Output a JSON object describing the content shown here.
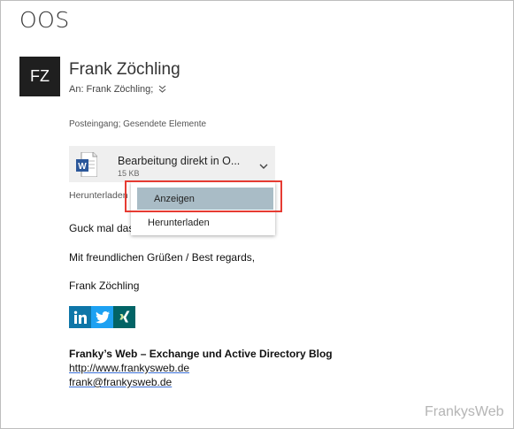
{
  "email": {
    "subject": "OOS",
    "avatar_initials": "FZ",
    "sender_name": "Frank Zöchling",
    "to_label": "An:",
    "to_value": "Frank Zöchling;",
    "folders": "Posteingang; Gesendete Elemente"
  },
  "attachment": {
    "icon": "word-document-icon",
    "name": "Bearbeitung direkt in O...",
    "size": "15 KB",
    "download_link": "Herunterladen"
  },
  "context_menu": {
    "items": [
      {
        "label": "Anzeigen",
        "selected": true
      },
      {
        "label": "Herunterladen",
        "selected": false
      }
    ],
    "highlight_color": "#e63b32"
  },
  "body": {
    "line1": "Guck mal das",
    "line2": "Mit freundlichen Grüßen / Best regards,",
    "line3": "Frank Zöchling"
  },
  "signature": {
    "social": [
      {
        "name": "linkedin-icon",
        "color": "#0e76a8"
      },
      {
        "name": "twitter-icon",
        "color": "#1da1f2"
      },
      {
        "name": "xing-icon",
        "color": "#026466"
      }
    ],
    "title": "Franky’s Web – Exchange und Active Directory Blog",
    "website": "http://www.frankysweb.de",
    "email": "frank@frankysweb.de"
  },
  "watermark": "FrankysWeb"
}
